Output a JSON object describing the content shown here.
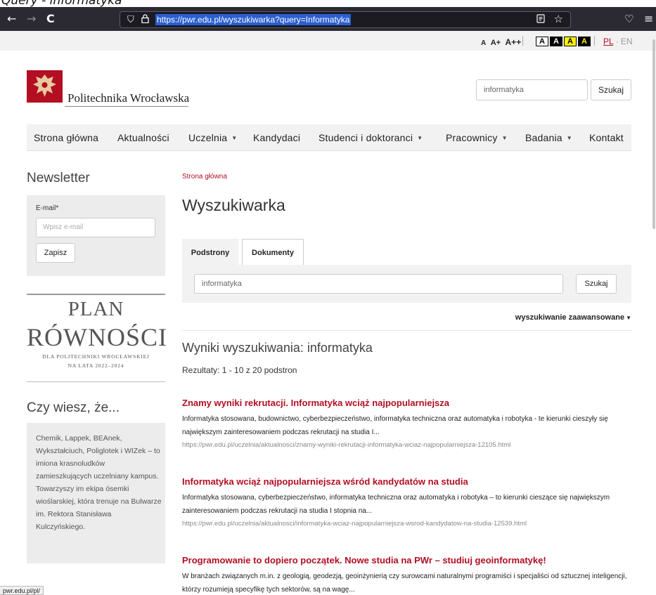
{
  "caption": "Query - informatyka",
  "browser": {
    "url": "https://pwr.edu.pl/wyszukiwarka?query=Informatyka",
    "back_glyph": "←",
    "forward_glyph": "→",
    "reload_glyph": "C",
    "menu_glyph": "≡",
    "pocket_glyph": "♡"
  },
  "a11y": {
    "font_sizes": [
      "A",
      "A+",
      "A++"
    ],
    "contrast_labels": [
      "A",
      "A",
      "A",
      "A"
    ],
    "lang_pl": "PL",
    "lang_sep": " · ",
    "lang_en": "EN"
  },
  "header": {
    "site_name": "Politechnika Wrocławska",
    "search_value": "informatyka",
    "search_button": "Szukaj"
  },
  "nav": {
    "items": [
      {
        "label": "Strona główna",
        "has_caret": false
      },
      {
        "label": "Aktualności",
        "has_caret": false
      },
      {
        "label": "Uczelnia",
        "has_caret": true
      },
      {
        "label": "Kandydaci",
        "has_caret": false
      },
      {
        "label": "Studenci i doktoranci",
        "has_caret": true
      },
      {
        "label": "Pracownicy",
        "has_caret": true
      },
      {
        "label": "Badania",
        "has_caret": true
      },
      {
        "label": "Kontakt",
        "has_caret": false
      }
    ],
    "caret": "▼"
  },
  "sidebar": {
    "newsletter_title": "Newsletter",
    "email_label": "E-mail*",
    "email_placeholder": "Wpisz e-mail",
    "subscribe_button": "Zapisz",
    "plan_line1": "PLAN",
    "plan_line2": "RÓWNOŚCI",
    "plan_line3": "DLA POLITECHNIKI WROCŁAWSKIEJ",
    "plan_line4": "NA LATA 2022–2024",
    "facts_title": "Czy wiesz, że...",
    "facts_text": "Chemik, Lappek, BEAnek, Wykształciuch, Poliglotek i WIZek – to imiona krasnoludków zamieszkujących uczelniany kampus. Towarzyszy im ekipa ósemki wioślarskiej, która trenuje na Bulwarze im. Rektora Stanisława Kulczyńskiego."
  },
  "status_bar": "pwr.edu.pl/pl/",
  "main": {
    "breadcrumb": "Strona główna",
    "title": "Wyszukiwarka",
    "tabs": [
      "Podstrony",
      "Dokumenty"
    ],
    "search_value": "informatyka",
    "search_button": "Szukaj",
    "advanced_link": "wyszukiwanie zaawansowane",
    "advanced_caret": "▼",
    "results_heading": "Wyniki wyszukiwania: informatyka",
    "results_count": "Rezultaty: 1 - 10 z 20 podstron",
    "results": [
      {
        "title": "Znamy wyniki rekrutacji. Informatyka wciąż najpopularniejsza",
        "desc": "Informatyka stosowana, budownictwo, cyberbezpieczeństwo, informatyka techniczna oraz automatyka i robotyka - te kierunki cieszyły się największym zainteresowaniem podczas rekrutacji na studia I...",
        "url": "https://pwr.edu.pl/uczelnia/aktualnosci/znamy-wyniki-rekrutacji-informatyka-wciaz-najpopularniejsza-12105.html"
      },
      {
        "title": "Informatyka wciąż najpopularniejsza wśród kandydatów na studia",
        "desc": "Informatyka stosowana, cyberbezpieczeństwo, informatyka techniczna oraz automatyka i robotyka – to kierunki cieszące się największym zainteresowaniem podczas rekrutacji na studia I stopnia na...",
        "url": "https://pwr.edu.pl/uczelnia/aktualnosci/informatyka-wciaz-najpopularniejsza-wsrod-kandydatow-na-studia-12539.html"
      },
      {
        "title": "Programowanie to dopiero początek. Nowe studia na PWr – studiuj geoinformatykę!",
        "desc": "W branżach związanych m.in. z geologią, geodezją, geoinżynierią czy surowcami naturalnymi programiści i specjaliści od sztucznej inteligencji, którzy rozumieją specyfikę tych sektorów, są na wagę...",
        "url": ""
      }
    ]
  },
  "colors": {
    "brand_red": "#b30e22",
    "toolbar_bg": "#2b2a33",
    "url_highlight": "#2a5fd0"
  }
}
